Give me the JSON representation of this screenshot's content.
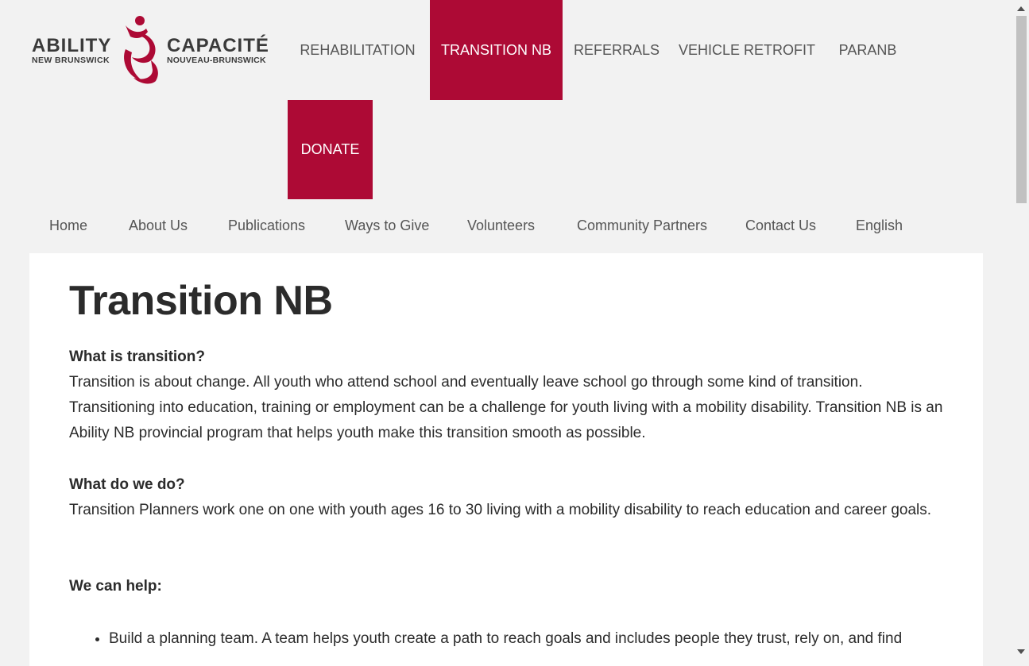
{
  "logo": {
    "word_left": "ABILITY",
    "word_right": "CAPACITÉ",
    "sub_left": "NEW BRUNSWICK",
    "sub_right": "NOUVEAU-BRUNSWICK"
  },
  "topnav": {
    "items": [
      "REHABILITATION",
      "TRANSITION NB",
      "REFERRALS",
      "VEHICLE RETROFIT",
      "PARANB"
    ],
    "donate": "DONATE",
    "active_index": 1
  },
  "subnav": {
    "items": [
      "Home",
      "About Us",
      "Publications",
      "Ways to Give",
      "Volunteers",
      "Community Partners",
      "Contact Us",
      "English"
    ]
  },
  "content": {
    "title": "Transition NB",
    "section1": {
      "heading": "What is transition?",
      "body": "Transition is about change. All youth who attend school and eventually leave school go through some kind of transition. Transitioning into education, training or employment can be a challenge for youth living with a mobility disability. Transition NB is an Ability NB provincial program that helps youth make this transition smooth as possible."
    },
    "section2": {
      "heading": "What do we do?",
      "body": "Transition Planners work one on one with youth ages 16 to 30 living with a mobility disability to reach education and career goals."
    },
    "section3": {
      "heading": "We can help:"
    },
    "list": [
      "Build a planning team.  A team helps youth create a path to reach goals and includes people they trust, rely on, and find"
    ]
  },
  "colors": {
    "accent": "#ad0a35",
    "background": "#f2f2f2",
    "text": "#2b2b2b"
  }
}
